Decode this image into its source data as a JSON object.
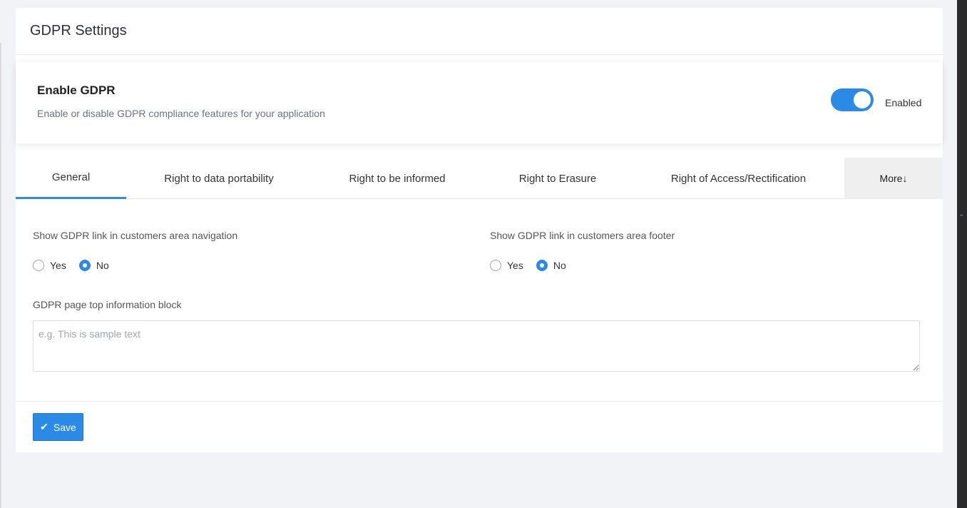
{
  "panel": {
    "title": "GDPR Settings"
  },
  "enable": {
    "title": "Enable GDPR",
    "description": "Enable or disable GDPR compliance features for your application",
    "toggle_state": "Enabled"
  },
  "tabs": [
    {
      "label": "General",
      "active": true
    },
    {
      "label": "Right to data portability"
    },
    {
      "label": "Right to be informed"
    },
    {
      "label": "Right to Erasure"
    },
    {
      "label": "Right of Access/Rectification"
    },
    {
      "label": "More↓"
    }
  ],
  "fields": {
    "nav_link": {
      "label": "Show GDPR link in customers area navigation",
      "yes": "Yes",
      "no": "No",
      "value": "No"
    },
    "footer_link": {
      "label": "Show GDPR link in customers area footer",
      "yes": "Yes",
      "no": "No",
      "value": "No"
    },
    "info_block": {
      "label": "GDPR page top information block",
      "placeholder": "e.g. This is sample text",
      "value": ""
    }
  },
  "save_label": "Save",
  "colors": {
    "accent": "#2b8ae6",
    "background": "#f2f3f7"
  },
  "icons": {
    "save": "check-icon",
    "more_strip": "chevron-down-icon"
  }
}
